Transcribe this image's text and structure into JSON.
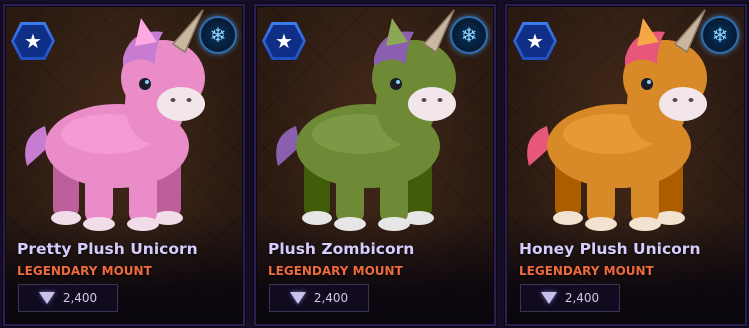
{
  "cards": [
    {
      "title": "Pretty Plush Unicorn",
      "subtitle": "LEGENDARY MOUNT",
      "price": "2,400",
      "body_color": "#e98cc7",
      "mane_color": "#c77cd2",
      "hoof_color": "#f1dde9",
      "star_icon": "star-icon",
      "badge_icon": "snowflake-icon"
    },
    {
      "title": "Plush Zombicorn",
      "subtitle": "LEGENDARY MOUNT",
      "price": "2,400",
      "body_color": "#6f8a36",
      "mane_color": "#8a5fb0",
      "hoof_color": "#e6e6e6",
      "star_icon": "star-icon",
      "badge_icon": "snowflake-icon"
    },
    {
      "title": "Honey Plush Unicorn",
      "subtitle": "LEGENDARY MOUNT",
      "price": "2,400",
      "body_color": "#d98a28",
      "mane_color": "#e7567b",
      "hoof_color": "#f3e2cf",
      "star_icon": "star-icon",
      "badge_icon": "snowflake-icon"
    }
  ],
  "colors": {
    "title": "#d6cdff",
    "subtitle": "#ef6a3c",
    "price_text": "#cfc8e8",
    "frame": "#2c1f4f"
  },
  "glyphs": {
    "star": "★",
    "snowflake": "❄"
  }
}
